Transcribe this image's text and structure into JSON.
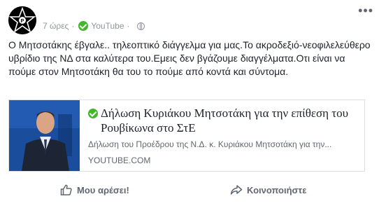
{
  "post": {
    "time": "7 ώρες",
    "via": "YouTube",
    "text": "Ο Μητσοτάκης έβγαλε.. τηλεοπτικό διάγγελμα για μας.Το ακροδεξιό-νεοφιλελεύθερο υβρίδιο της ΝΔ στα καλύτερα του.Εμεις δεν βγάζουμε διαγγέλματα.Οτι είναι να πούμε στον Μητσοτάκη θα του το πούμε από κοντά και σύντομα."
  },
  "card": {
    "title": "Δήλωση Κυριάκου Μητσοτάκη για την επίθεση του Ρουβίκωνα στο ΣτΕ",
    "description": "Δήλωση του Προέδρου της Ν.Δ. κ. Κυριάκου Μητσοτάκη για την...",
    "domain": "YOUTUBE.COM"
  },
  "actions": {
    "like": "Μου αρέσει!",
    "share": "Κοινοποιήστε"
  },
  "icons": {
    "avatar": "black-star-logo",
    "verified": "check-circle-icon",
    "audience": "globe-icon",
    "more": "more-options-icon",
    "like": "thumbs-up-icon",
    "share": "share-arrow-icon"
  },
  "colors": {
    "verified": "#42b72a",
    "meta_text": "#90949c",
    "action_text": "#606770"
  }
}
